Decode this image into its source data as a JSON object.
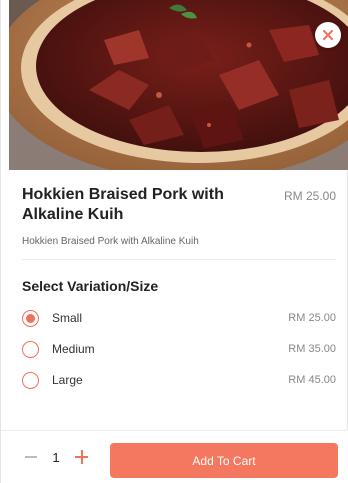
{
  "item": {
    "title": "Hokkien Braised Pork with Alkaline Kuih",
    "price": "RM 25.00",
    "description": "Hokkien Braised Pork with Alkaline Kuih",
    "image": "food-photo"
  },
  "variation": {
    "heading": "Select Variation/Size",
    "options": [
      {
        "label": "Small",
        "price": "RM 25.00",
        "selected": true
      },
      {
        "label": "Medium",
        "price": "RM 35.00",
        "selected": false
      },
      {
        "label": "Large",
        "price": "RM 45.00",
        "selected": false
      }
    ]
  },
  "footer": {
    "quantity": "1",
    "add_label": "Add To Cart"
  },
  "colors": {
    "accent": "#f4775f",
    "radio": "#f0705a"
  },
  "icons": {
    "close": "close-icon",
    "minus": "minus-icon",
    "plus": "plus-icon"
  }
}
